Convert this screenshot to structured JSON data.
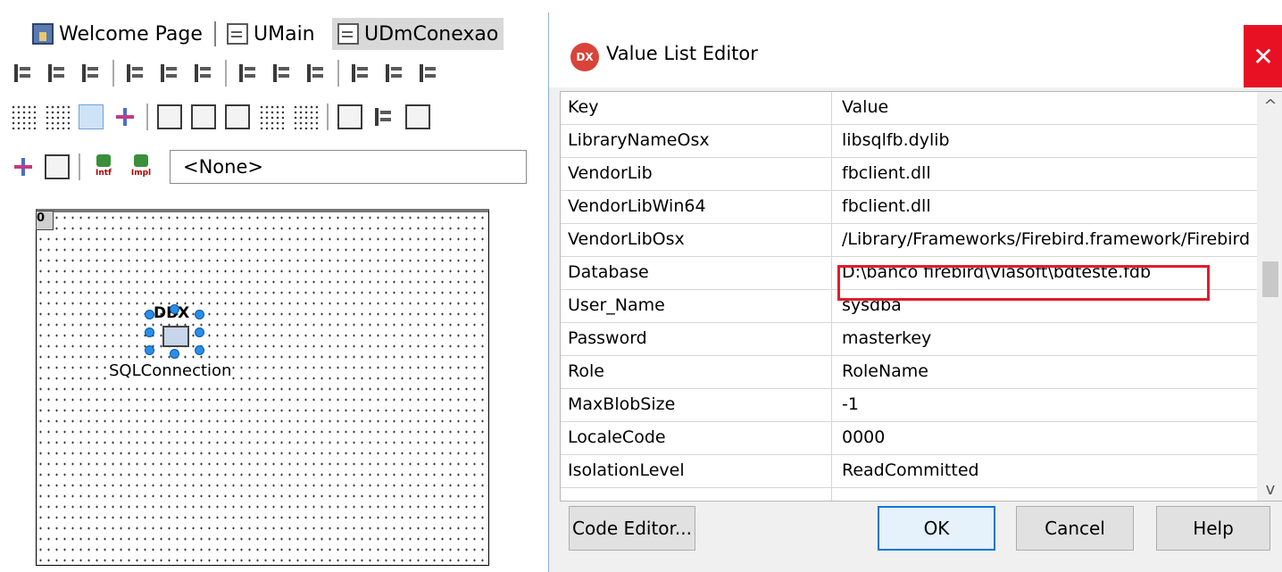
{
  "tabs": [
    {
      "label": "Welcome Page",
      "icon": "home-page-icon"
    },
    {
      "label": "UMain",
      "icon": "unit-file-icon"
    },
    {
      "label": "UDmConexao",
      "icon": "unit-file-icon",
      "active": true
    }
  ],
  "toolbar": {
    "interface_label": "Intf",
    "impl_label": "Impl",
    "combo_value": "<None>"
  },
  "designer": {
    "corner_label": "0",
    "component_glyph": "DBX",
    "component_label": "SQLConnection"
  },
  "dialog": {
    "logo_text": "DX",
    "title": "Value List Editor",
    "close_glyph": "✕",
    "columns": {
      "key": "Key",
      "value": "Value"
    },
    "rows": [
      {
        "key": "LibraryNameOsx",
        "value": "libsqlfb.dylib"
      },
      {
        "key": "VendorLib",
        "value": "fbclient.dll"
      },
      {
        "key": "VendorLibWin64",
        "value": "fbclient.dll"
      },
      {
        "key": "VendorLibOsx",
        "value": "/Library/Frameworks/Firebird.framework/Firebird"
      },
      {
        "key": "Database",
        "value": "D:\\banco firebird\\Viasoft\\bdteste.fdb",
        "highlighted": true
      },
      {
        "key": "User_Name",
        "value": "sysdba"
      },
      {
        "key": "Password",
        "value": "masterkey"
      },
      {
        "key": "Role",
        "value": "RoleName"
      },
      {
        "key": "MaxBlobSize",
        "value": "-1"
      },
      {
        "key": "LocaleCode",
        "value": "0000"
      },
      {
        "key": "IsolationLevel",
        "value": "ReadCommitted"
      }
    ],
    "scroll_up": "^",
    "scroll_down": "v",
    "buttons": {
      "code_editor": "Code Editor...",
      "ok": "OK",
      "cancel": "Cancel",
      "help": "Help"
    },
    "highlight_color": "#e31b2c",
    "close_color": "#e81123"
  }
}
